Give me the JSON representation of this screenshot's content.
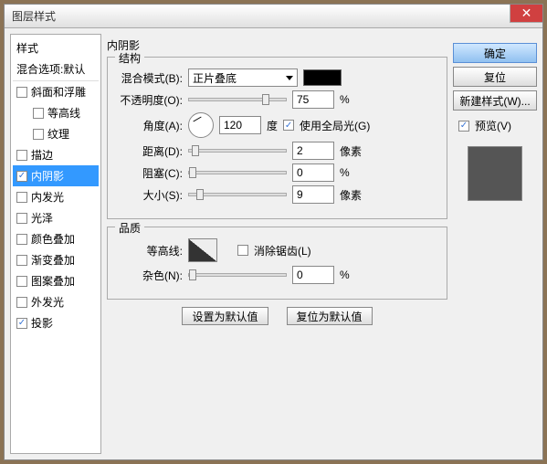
{
  "title": "图层样式",
  "sidebar": {
    "header": "样式",
    "sub": "混合选项:默认",
    "items": [
      {
        "label": "斜面和浮雕",
        "checked": false,
        "indent": false
      },
      {
        "label": "等高线",
        "checked": false,
        "indent": true
      },
      {
        "label": "纹理",
        "checked": false,
        "indent": true
      },
      {
        "label": "描边",
        "checked": false,
        "indent": false
      },
      {
        "label": "内阴影",
        "checked": true,
        "indent": false,
        "selected": true
      },
      {
        "label": "内发光",
        "checked": false,
        "indent": false
      },
      {
        "label": "光泽",
        "checked": false,
        "indent": false
      },
      {
        "label": "颜色叠加",
        "checked": false,
        "indent": false
      },
      {
        "label": "渐变叠加",
        "checked": false,
        "indent": false
      },
      {
        "label": "图案叠加",
        "checked": false,
        "indent": false
      },
      {
        "label": "外发光",
        "checked": false,
        "indent": false
      },
      {
        "label": "投影",
        "checked": true,
        "indent": false
      }
    ]
  },
  "panel": {
    "title": "内阴影",
    "structure": {
      "legend": "结构",
      "blendMode": {
        "label": "混合模式(B):",
        "value": "正片叠底",
        "color": "#000000"
      },
      "opacity": {
        "label": "不透明度(O):",
        "value": "75",
        "unit": "%",
        "pos": 75
      },
      "angle": {
        "label": "角度(A):",
        "value": "120",
        "unit": "度",
        "globalLabel": "使用全局光(G)",
        "globalChecked": true
      },
      "distance": {
        "label": "距离(D):",
        "value": "2",
        "unit": "像素",
        "pos": 3
      },
      "choke": {
        "label": "阻塞(C):",
        "value": "0",
        "unit": "%",
        "pos": 0
      },
      "size": {
        "label": "大小(S):",
        "value": "9",
        "unit": "像素",
        "pos": 8
      }
    },
    "quality": {
      "legend": "品质",
      "contour": {
        "label": "等高线:",
        "antiAliasLabel": "消除锯齿(L)",
        "antiAliasChecked": false
      },
      "noise": {
        "label": "杂色(N):",
        "value": "0",
        "unit": "%",
        "pos": 0
      }
    },
    "buttons": {
      "default": "设置为默认值",
      "reset": "复位为默认值"
    }
  },
  "right": {
    "ok": "确定",
    "cancel": "复位",
    "newStyle": "新建样式(W)...",
    "preview": {
      "label": "预览(V)",
      "checked": true
    }
  }
}
